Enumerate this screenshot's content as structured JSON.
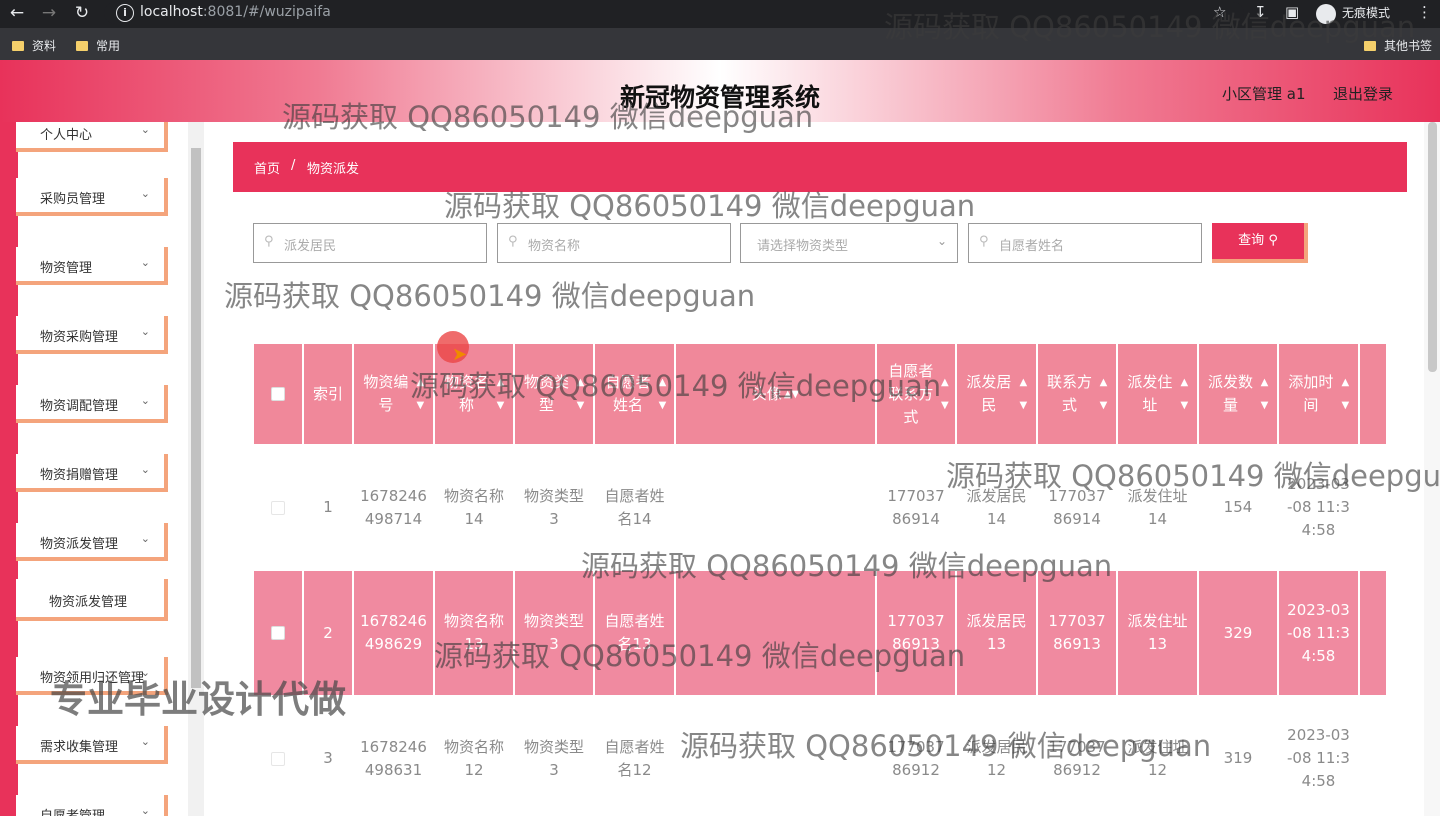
{
  "browser": {
    "url_host": "localhost",
    "url_rest": ":8081/#/wuzipaifa",
    "incognito_label": "无痕模式",
    "bookmarks": [
      "资料",
      "常用"
    ],
    "other_bookmarks": "其他书签"
  },
  "header": {
    "title": "新冠物资管理系统",
    "user": "小区管理 a1",
    "logout": "退出登录"
  },
  "sidebar": {
    "items": [
      {
        "label": "个人中心"
      },
      {
        "label": "采购员管理"
      },
      {
        "label": "物资管理"
      },
      {
        "label": "物资采购管理"
      },
      {
        "label": "物资调配管理"
      },
      {
        "label": "物资捐赠管理"
      },
      {
        "label": "物资派发管理"
      },
      {
        "label": "物资领用归还管理"
      },
      {
        "label": "需求收集管理"
      },
      {
        "label": "自愿者管理"
      }
    ],
    "active_sub": "物资派发管理"
  },
  "breadcrumb": {
    "home": "首页",
    "sep": "/",
    "current": "物资派发"
  },
  "search": {
    "resident_placeholder": "派发居民",
    "name_placeholder": "物资名称",
    "type_placeholder": "请选择物资类型",
    "volunteer_placeholder": "自愿者姓名",
    "query_label": "查询"
  },
  "table": {
    "headers": [
      "索引",
      "物资编号",
      "物资名称",
      "物资类型",
      "自愿者姓名",
      "头像",
      "自愿者联系方式",
      "派发居民",
      "联系方式",
      "派发住址",
      "派发数量",
      "添加时间"
    ],
    "rows": [
      {
        "index": "1",
        "code": "1678246498714",
        "name": "物资名称14",
        "type": "物资类型3",
        "volunteer": "自愿者姓名14",
        "vphone": "17703786914",
        "resident": "派发居民14",
        "phone": "17703786914",
        "address": "派发住址14",
        "qty": "154",
        "time": "2023-03-08 11:34:58"
      },
      {
        "index": "2",
        "code": "1678246498629",
        "name": "物资名称13",
        "type": "物资类型3",
        "volunteer": "自愿者姓名13",
        "vphone": "17703786913",
        "resident": "派发居民13",
        "phone": "17703786913",
        "address": "派发住址13",
        "qty": "329",
        "time": "2023-03-08 11:34:58"
      },
      {
        "index": "3",
        "code": "1678246498631",
        "name": "物资名称12",
        "type": "物资类型3",
        "volunteer": "自愿者姓名12",
        "vphone": "17703786912",
        "resident": "派发居民12",
        "phone": "17703786912",
        "address": "派发住址12",
        "qty": "319",
        "time": "2023-03-08 11:34:58"
      }
    ]
  },
  "watermarks": {
    "text": "源码获取 QQ86050149 微信deepguan",
    "big": "专业毕业设计代做"
  },
  "colors": {
    "accent": "#e8325a",
    "border_accent": "#f4a47c",
    "table_head": "#f0889a"
  }
}
